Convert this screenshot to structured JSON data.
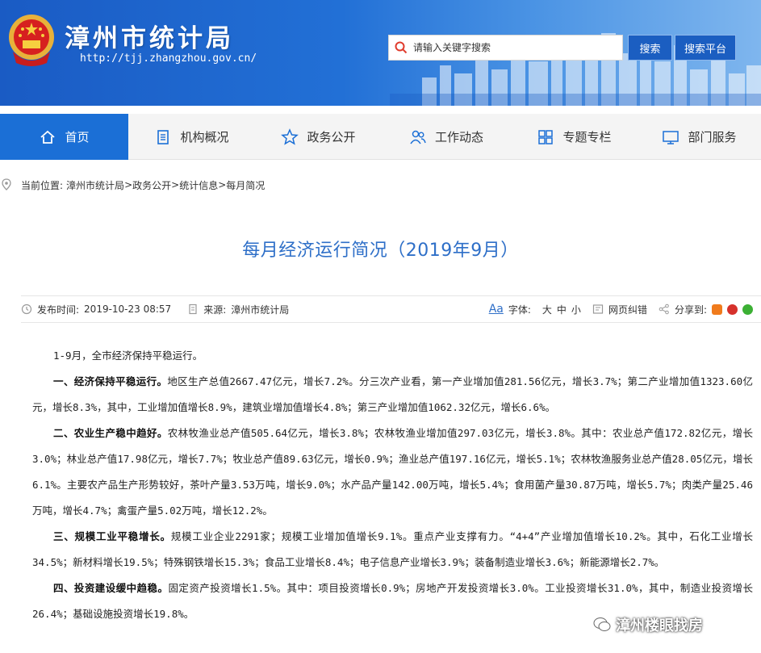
{
  "header": {
    "site_title": "漳州市统计局",
    "site_url": "http://tjj.zhangzhou.gov.cn/",
    "search_placeholder": "请输入关键字搜索",
    "search_button": "搜索",
    "platform_button": "搜索平台",
    "colors": {
      "banner": "#1a5bc4",
      "button": "#1b5ec1"
    }
  },
  "nav": {
    "items": [
      {
        "label": "首页",
        "icon": "home-icon",
        "active": true
      },
      {
        "label": "机构概况",
        "icon": "document-icon"
      },
      {
        "label": "政务公开",
        "icon": "star-icon"
      },
      {
        "label": "工作动态",
        "icon": "people-icon"
      },
      {
        "label": "专题专栏",
        "icon": "grid-icon"
      },
      {
        "label": "部门服务",
        "icon": "monitor-icon"
      }
    ],
    "active_color": "#1b6fd6"
  },
  "breadcrumb": {
    "prefix": "当前位置:",
    "items": [
      "漳州市统计局",
      "政务公开",
      "统计信息",
      "每月简况"
    ],
    "separator": ">"
  },
  "article": {
    "title": "每月经济运行简况（2019年9月）",
    "publish_label": "发布时间:",
    "publish_time": "2019-10-23 08:57",
    "source_label": "来源:",
    "source": "漳州市统计局",
    "font_icon_text": "Aa",
    "font_label": "字体:",
    "font_sizes": [
      "大",
      "中",
      "小"
    ],
    "error_label": "网页纠错",
    "share_label": "分享到:",
    "paragraphs": [
      {
        "lead": "",
        "text": "1-9月，全市经济保持平稳运行。"
      },
      {
        "lead": "一、经济保持平稳运行。",
        "text": "地区生产总值2667.47亿元，增长7.2%。分三次产业看，第一产业增加值281.56亿元，增长3.7%；第二产业增加值1323.60亿元，增长8.3%，其中，工业增加值增长8.9%，建筑业增加值增长4.8%；第三产业增加值1062.32亿元，增长6.6%。"
      },
      {
        "lead": "二、农业生产稳中趋好。",
        "text": "农林牧渔业总产值505.64亿元，增长3.8%；农林牧渔业增加值297.03亿元，增长3.8%。其中：农业总产值172.82亿元，增长3.0%；林业总产值17.98亿元，增长7.7%；牧业总产值89.63亿元，增长0.9%；渔业总产值197.16亿元，增长5.1%；农林牧渔服务业总产值28.05亿元，增长6.1%。主要农产品生产形势较好，茶叶产量3.53万吨，增长9.0%；水产品产量142.00万吨，增长5.4%；食用菌产量30.87万吨，增长5.7%；肉类产量25.46万吨，增长4.7%；禽蛋产量5.02万吨，增长12.2%。"
      },
      {
        "lead": "三、规模工业平稳增长。",
        "text": "规模工业企业2291家；规模工业增加值增长9.1%。重点产业支撑有力。“4+4”产业增加值增长10.2%。其中，石化工业增长34.5%；新材料增长19.5%；特殊钢铁增长15.3%；食品工业增长8.4%；电子信息产业增长3.9%；装备制造业增长3.6%；新能源增长2.7%。"
      },
      {
        "lead": "四、投资建设缓中趋稳。",
        "text": "固定资产投资增长1.5%。其中：项目投资增长0.9%；房地产开发投资增长3.0%。工业投资增长31.0%，其中，制造业投资增长26.4%；基础设施投资增长19.8%。"
      }
    ]
  },
  "watermark": {
    "text": "漳州楼眼找房"
  }
}
